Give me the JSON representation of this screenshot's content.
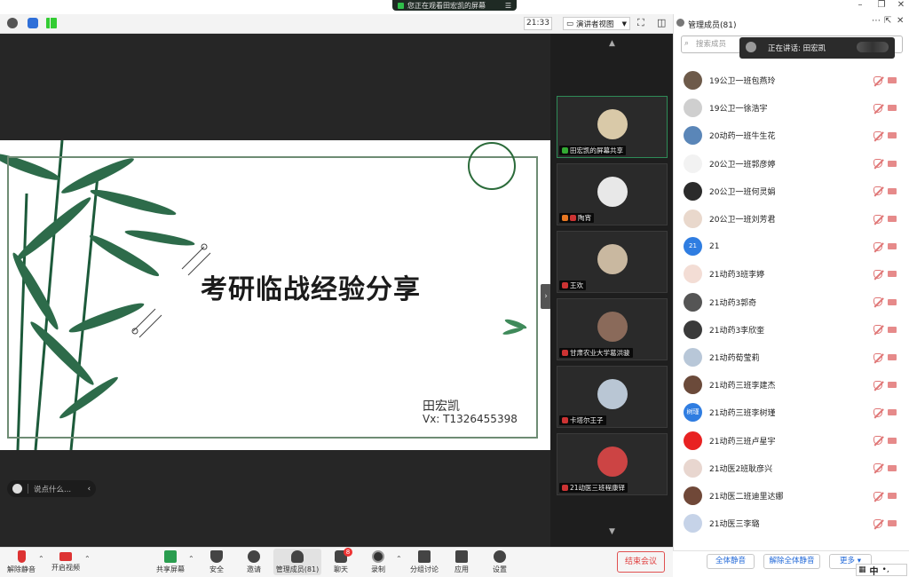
{
  "titlebar": {
    "viewing_text": "您正在观看田宏凯的屏幕",
    "menu_icon": "menu-icon"
  },
  "toolbar": {
    "time": "21:33",
    "presenter_view": "演讲者视图"
  },
  "slide": {
    "title": "考研临战经验分享",
    "presenter": "田宏凯",
    "vx": "Vx: T1326455398"
  },
  "chat": {
    "placeholder": "说点什么..."
  },
  "gallery": {
    "tiles": [
      {
        "label": "田宏凯的屏幕共享",
        "color": "#d9c9a8"
      },
      {
        "label": "陶宵",
        "color": "#e8e8e8"
      },
      {
        "label": "王欢",
        "color": "#c9b8a0"
      },
      {
        "label": "甘肃农业大学葛洪骏",
        "color": "#8a6a5a"
      },
      {
        "label": "卡塔尔王子",
        "color": "#b9c6d4"
      },
      {
        "label": "21动医三班程康铎",
        "color": "#c44"
      }
    ]
  },
  "panel": {
    "title": "管理成员(81)",
    "search_placeholder": "搜索成员",
    "speaking": "正在讲话: 田宏凯",
    "members": [
      {
        "name": "19公卫一班包燕玲",
        "color": "#6d5a4a",
        "initial": ""
      },
      {
        "name": "19公卫一徐浩宇",
        "color": "#cfcfcf",
        "initial": ""
      },
      {
        "name": "20动药一班牛生花",
        "color": "#5a86b8",
        "initial": ""
      },
      {
        "name": "20公卫一班郭彦婷",
        "color": "#f2f2f2",
        "initial": ""
      },
      {
        "name": "20公卫一班何灵娟",
        "color": "#2b2b2b",
        "initial": ""
      },
      {
        "name": "20公卫一班刘芳君",
        "color": "#e9d8cc",
        "initial": ""
      },
      {
        "name": "21",
        "color": "#2f7de1",
        "initial": "21"
      },
      {
        "name": "21动药3班李婷",
        "color": "#f3ddd5",
        "initial": ""
      },
      {
        "name": "21动药3郭奇",
        "color": "#555555",
        "initial": ""
      },
      {
        "name": "21动药3李欣奎",
        "color": "#3a3a3a",
        "initial": ""
      },
      {
        "name": "21动药荀莹莉",
        "color": "#b8c7d8",
        "initial": ""
      },
      {
        "name": "21动药三班李建杰",
        "color": "#6b4a3a",
        "initial": ""
      },
      {
        "name": "21动药三班李树瑾",
        "color": "#2f7de1",
        "initial": "树瑾"
      },
      {
        "name": "21动药三班卢星宇",
        "color": "#e82222",
        "initial": ""
      },
      {
        "name": "21动医2班耿彦兴",
        "color": "#e8d6cf",
        "initial": ""
      },
      {
        "name": "21动医二班迪里达娜",
        "color": "#704838",
        "initial": ""
      },
      {
        "name": "21动医三李璐",
        "color": "#c6d3e8",
        "initial": ""
      }
    ],
    "mute_all": "全体静音",
    "unmute_all": "解除全体静音",
    "more": "更多"
  },
  "ime": {
    "text": "中"
  },
  "bottombar": {
    "unmute": "解除静音",
    "video": "开启视频",
    "share": "共享屏幕",
    "security": "安全",
    "invite": "邀请",
    "members": "管理成员(81)",
    "chat": "聊天",
    "chat_badge": "8",
    "record": "录制",
    "breakout": "分组讨论",
    "apps": "应用",
    "settings": "设置",
    "end": "结束会议"
  }
}
